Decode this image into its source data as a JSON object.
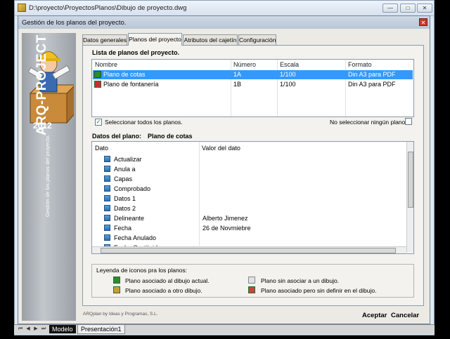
{
  "window": {
    "title": "D:\\proyecto\\ProyectosPlanos\\Dibujo de proyecto.dwg",
    "min_glyph": "—",
    "max_glyph": "□",
    "close_glyph": "✕"
  },
  "dialog": {
    "title": "Gestión de los planos del proyecto.",
    "close_glyph": "✕"
  },
  "banner": {
    "year": "2012",
    "main": "ARQ-PROJECT",
    "sub": "Gestión de los planos del proyecto."
  },
  "tabs": [
    {
      "label": "Datos generales",
      "active": false
    },
    {
      "label": "Planos del proyecto",
      "active": true
    },
    {
      "label": "Atributos del cajetín",
      "active": false
    },
    {
      "label": "Configuración",
      "active": false
    }
  ],
  "plans": {
    "group_label": "Lista de planos del proyecto.",
    "columns": [
      "Nombre",
      "Número",
      "Escala",
      "Formato"
    ],
    "rows": [
      {
        "name": "Plano de cotas",
        "number": "1A",
        "scale": "1/100",
        "format": "Din A3 para PDF",
        "selected": true
      },
      {
        "name": "Plano de fontanería",
        "number": "1B",
        "scale": "1/100",
        "format": "Din A3 para PDF",
        "selected": false
      }
    ],
    "select_all": "Seleccionar todos los planos.",
    "select_all_checked": true,
    "select_none": "No seleccionar ningún plano.",
    "select_none_checked": false
  },
  "plan_data": {
    "label": "Datos del plano:",
    "plan_name": "Plano de cotas",
    "columns": [
      "Dato",
      "Valor del dato"
    ],
    "rows": [
      {
        "name": "Actualizar",
        "value": ""
      },
      {
        "name": "Anula a",
        "value": ""
      },
      {
        "name": "Capas",
        "value": ""
      },
      {
        "name": "Comprobado",
        "value": ""
      },
      {
        "name": "Datos 1",
        "value": ""
      },
      {
        "name": "Datos 2",
        "value": ""
      },
      {
        "name": "Delineante",
        "value": "Alberto Jimenez"
      },
      {
        "name": "Fecha",
        "value": "26 de Novmiebre"
      },
      {
        "name": "Fecha Anulado",
        "value": ""
      },
      {
        "name": "Fecha Sustituido",
        "value": ""
      }
    ]
  },
  "legend": {
    "title": "Leyenda de iconos pra los planos:",
    "items": [
      {
        "text": "Plano asociado al dibujo actual.",
        "icon": "plan-current-icon",
        "color": "#2e8b2e"
      },
      {
        "text": "Plano asociado a otro dibujo.",
        "icon": "plan-other-icon",
        "color": "#c8a030"
      },
      {
        "text": "Plano sin asociar a un dibujo.",
        "icon": "plan-unassociated-icon",
        "color": "#d0d0d0"
      },
      {
        "text": "Plano asociado pero sin definir en el dibujo.",
        "icon": "plan-undefined-icon",
        "color": "#d04040"
      }
    ]
  },
  "footer": {
    "brand": "ARQplan by Ideas y Programas, S.L.",
    "accept": "Aceptar",
    "cancel": "Cancelar"
  },
  "sheet_tabs": [
    "Modelo",
    "Presentación1"
  ],
  "colors": {
    "selection": "#3399ff",
    "accent": "#2f6fb0"
  }
}
